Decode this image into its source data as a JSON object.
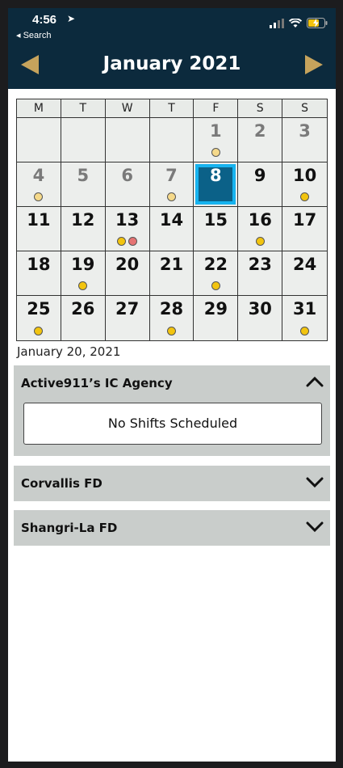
{
  "status": {
    "time": "4:56",
    "back_label": "◂ Search"
  },
  "header": {
    "title": "January 2021"
  },
  "calendar": {
    "weekdays": [
      "M",
      "T",
      "W",
      "T",
      "F",
      "S",
      "S"
    ],
    "days": [
      {
        "label": "",
        "state": "empty",
        "dots": []
      },
      {
        "label": "",
        "state": "empty",
        "dots": []
      },
      {
        "label": "",
        "state": "empty",
        "dots": []
      },
      {
        "label": "",
        "state": "empty",
        "dots": []
      },
      {
        "label": "1",
        "state": "past",
        "dots": [
          "#f5d98a"
        ]
      },
      {
        "label": "2",
        "state": "past",
        "dots": []
      },
      {
        "label": "3",
        "state": "past",
        "dots": []
      },
      {
        "label": "4",
        "state": "past",
        "dots": [
          "#f5d98a"
        ]
      },
      {
        "label": "5",
        "state": "past",
        "dots": []
      },
      {
        "label": "6",
        "state": "past",
        "dots": []
      },
      {
        "label": "7",
        "state": "past",
        "dots": [
          "#f5d98a"
        ]
      },
      {
        "label": "8",
        "state": "today",
        "dots": []
      },
      {
        "label": "9",
        "state": "normal",
        "dots": []
      },
      {
        "label": "10",
        "state": "normal",
        "dots": [
          "#f2c40f"
        ]
      },
      {
        "label": "11",
        "state": "normal",
        "dots": []
      },
      {
        "label": "12",
        "state": "normal",
        "dots": []
      },
      {
        "label": "13",
        "state": "normal",
        "dots": [
          "#f2c40f",
          "#e57373"
        ]
      },
      {
        "label": "14",
        "state": "normal",
        "dots": []
      },
      {
        "label": "15",
        "state": "normal",
        "dots": []
      },
      {
        "label": "16",
        "state": "normal",
        "dots": [
          "#f2c40f"
        ]
      },
      {
        "label": "17",
        "state": "normal",
        "dots": []
      },
      {
        "label": "18",
        "state": "normal",
        "dots": []
      },
      {
        "label": "19",
        "state": "normal",
        "dots": [
          "#f2c40f"
        ]
      },
      {
        "label": "20",
        "state": "normal",
        "dots": []
      },
      {
        "label": "21",
        "state": "normal",
        "dots": []
      },
      {
        "label": "22",
        "state": "normal",
        "dots": [
          "#f2c40f"
        ]
      },
      {
        "label": "23",
        "state": "normal",
        "dots": []
      },
      {
        "label": "24",
        "state": "normal",
        "dots": []
      },
      {
        "label": "25",
        "state": "normal",
        "dots": [
          "#f2c40f"
        ]
      },
      {
        "label": "26",
        "state": "normal",
        "dots": []
      },
      {
        "label": "27",
        "state": "normal",
        "dots": []
      },
      {
        "label": "28",
        "state": "normal",
        "dots": [
          "#f2c40f"
        ]
      },
      {
        "label": "29",
        "state": "normal",
        "dots": []
      },
      {
        "label": "30",
        "state": "normal",
        "dots": []
      },
      {
        "label": "31",
        "state": "normal",
        "dots": [
          "#f2c40f"
        ]
      }
    ]
  },
  "selected_date": "January 20, 2021",
  "agencies": [
    {
      "name": "Active911’s IC Agency",
      "expanded": true,
      "message": "No Shifts Scheduled"
    },
    {
      "name": "Corvallis FD",
      "expanded": false
    },
    {
      "name": "Shangri-La FD",
      "expanded": false
    }
  ],
  "colors": {
    "header_bg": "#0c2a3d",
    "accent_gold": "#c6a35c",
    "today_fill": "#0b6188",
    "today_border": "#17b3ef",
    "shift_dot": "#f2c40f",
    "past_shift_dot": "#f5d98a",
    "alert_dot": "#e57373",
    "agency_bg": "#c9cdcb"
  }
}
